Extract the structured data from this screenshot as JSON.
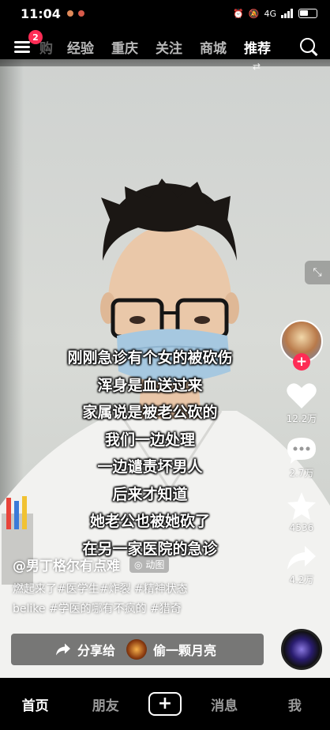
{
  "status_bar": {
    "time": "11:04",
    "network": "4G"
  },
  "top_nav": {
    "menu_badge": "2",
    "tabs": [
      "购",
      "经验",
      "重庆",
      "关注",
      "商城",
      "推荐"
    ],
    "active_tab": "推荐",
    "icons": [
      "menu-icon",
      "search-icon"
    ]
  },
  "video": {
    "subtitles": [
      "刚刚急诊有个女的被砍伤",
      "浑身是血送过来",
      "家属说是被老公砍的",
      "我们一边处理",
      "一边谴责坏男人",
      "后来才知道",
      "她老公也被她砍了",
      "在另一家医院的急诊"
    ]
  },
  "side_rail": {
    "likes": "12.2万",
    "comments": "2.7万",
    "favorites": "4536",
    "shares": "4.2万",
    "icons": [
      "heart-icon",
      "comment-icon",
      "star-icon",
      "share-icon"
    ]
  },
  "post": {
    "author": "@男丁格尔有点难",
    "tag": "动图",
    "caption_line1": "燃起来了#医学生#炸裂 #精神状态",
    "caption_line2": "belike #学医的哪有不疯的 #猎奇"
  },
  "share_bar": {
    "label": "分享给",
    "target": "偷一颗月亮"
  },
  "bottom_nav": {
    "items": [
      "首页",
      "朋友",
      "+",
      "消息",
      "我"
    ],
    "active": "首页"
  },
  "colors": {
    "accent": "#fe2c55",
    "background": "#000000"
  }
}
